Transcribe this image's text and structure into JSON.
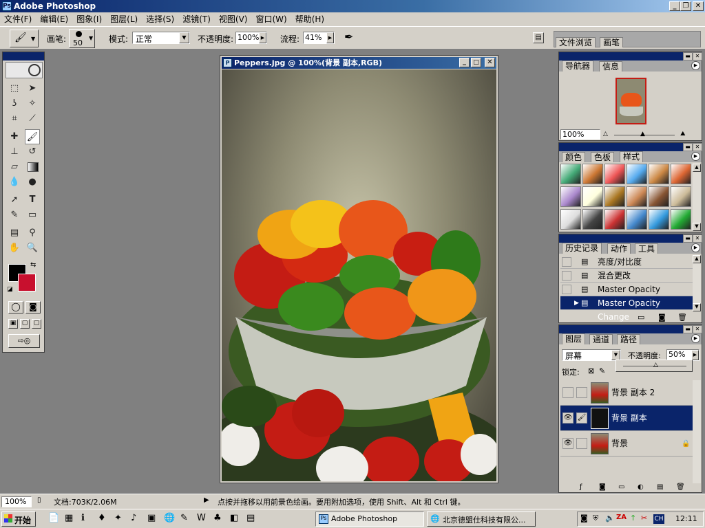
{
  "app": {
    "title": "Adobe Photoshop"
  },
  "menu": [
    "文件(F)",
    "编辑(E)",
    "图象(I)",
    "图层(L)",
    "选择(S)",
    "滤镜(T)",
    "视图(V)",
    "窗口(W)",
    "帮助(H)"
  ],
  "options": {
    "brush_label": "画笔:",
    "brush_size": "50",
    "mode_label": "模式:",
    "mode_value": "正常",
    "opacity_label": "不透明度:",
    "opacity_value": "100%",
    "flow_label": "流程:",
    "flow_value": "41%",
    "palette_tabs": [
      "文件浏览",
      "画笔"
    ]
  },
  "document": {
    "title": "Peppers.jpg @ 100%(背景 副本,RGB)"
  },
  "navigator": {
    "tabs": [
      "导航器",
      "信息"
    ],
    "zoom": "100%"
  },
  "swatches": {
    "tabs": [
      "颜色",
      "色板",
      "样式"
    ]
  },
  "history": {
    "tabs": [
      "历史记录",
      "动作",
      "工具"
    ],
    "items": [
      "亮度/对比度",
      "混合更改",
      "Master Opacity Change",
      "Master Opacity Change"
    ]
  },
  "layers": {
    "tabs": [
      "图层",
      "通道",
      "路径"
    ],
    "blend_mode": "屏幕",
    "opacity_label": "不透明度:",
    "opacity_value": "50%",
    "lock_label": "锁定:",
    "items": [
      "背景 副本 2",
      "背景 副本",
      "背景"
    ]
  },
  "status": {
    "zoom": "100%",
    "doc_info": "文档:703K/2.06M",
    "hint": "点按并拖移以用前景色绘画。要用附加选项，使用 Shift、Alt 和 Ctrl 键。"
  },
  "taskbar": {
    "start": "开始",
    "tasks": [
      "Adobe Photoshop",
      "北京德盟仕科技有限公..."
    ],
    "tray_ime": "CH",
    "clock": "12:11"
  },
  "colors": {
    "foreground": "#000000",
    "background": "#c8102e",
    "accent": "#0a246a"
  }
}
